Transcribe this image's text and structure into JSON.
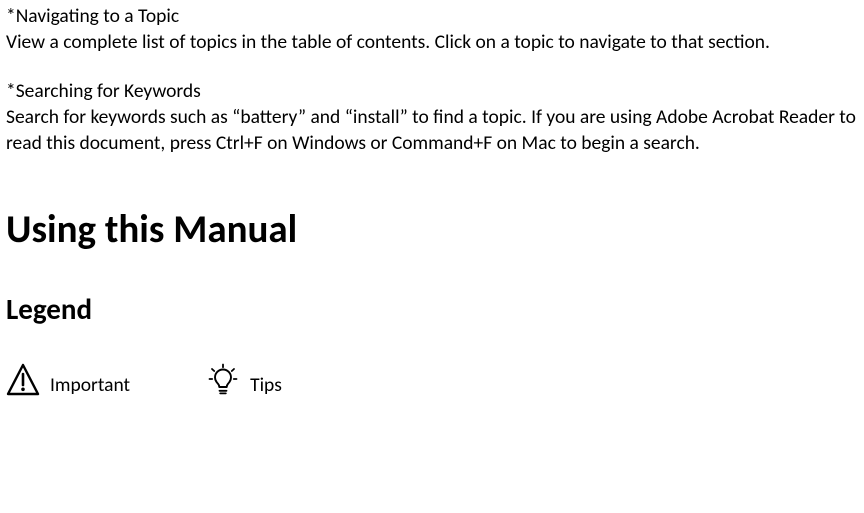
{
  "sections": {
    "navigating": {
      "heading": "*Navigating to a Topic",
      "body": "View a complete list of topics in the table of contents. Click on a topic to navigate to that section."
    },
    "searching": {
      "heading": "*Searching for Keywords",
      "body": "Search for keywords such as “battery” and “install” to find a topic. If you are using Adobe Acrobat Reader to read this document, press Ctrl+F on Windows or Command+F on Mac to begin a search."
    }
  },
  "title": "Using this Manual",
  "legend": {
    "heading": "Legend",
    "items": {
      "important": {
        "label": "Important"
      },
      "tips": {
        "label": "Tips"
      }
    }
  }
}
